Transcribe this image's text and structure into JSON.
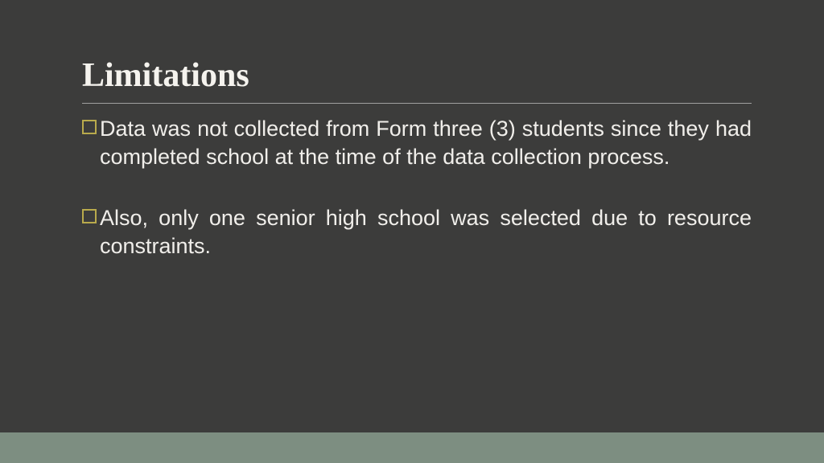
{
  "title": "Limitations",
  "bullets": [
    {
      "text": "Data was not collected from Form three (3) students since they had completed school at the time of the data collection process."
    },
    {
      "text": "Also, only one senior high school was selected due to resource constraints."
    }
  ],
  "colors": {
    "background": "#3c3c3b",
    "text": "#f0eeea",
    "bullet_border": "#b9aa4c",
    "bottom_bar": "#7d8e81"
  }
}
